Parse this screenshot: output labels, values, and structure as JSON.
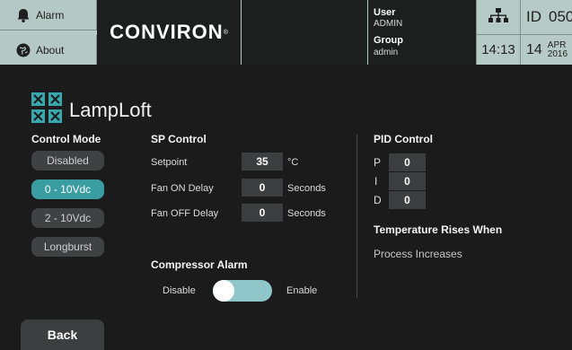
{
  "header": {
    "alarm_label": "Alarm",
    "about_label": "About",
    "brand": "CONVIRON",
    "user_heading": "User",
    "user_value": "ADMIN",
    "group_heading": "Group",
    "group_value": "admin",
    "id_label": "ID",
    "id_value": "050",
    "time": "14:13",
    "day": "14",
    "month": "APR",
    "year": "2016"
  },
  "page": {
    "title": "LampLoft"
  },
  "control_mode": {
    "heading": "Control Mode",
    "options": [
      "Disabled",
      "0 - 10Vdc",
      "2 - 10Vdc",
      "Longburst"
    ],
    "selected": "0 - 10Vdc"
  },
  "sp_control": {
    "heading": "SP Control",
    "setpoint_label": "Setpoint",
    "setpoint_value": "35",
    "setpoint_unit": "°C",
    "fan_on_label": "Fan ON Delay",
    "fan_on_value": "0",
    "fan_on_unit": "Seconds",
    "fan_off_label": "Fan OFF Delay",
    "fan_off_value": "0",
    "fan_off_unit": "Seconds"
  },
  "compressor_alarm": {
    "heading": "Compressor Alarm",
    "disable_label": "Disable",
    "enable_label": "Enable",
    "state": "Disable"
  },
  "pid_control": {
    "heading": "PID Control",
    "p_label": "P",
    "p_value": "0",
    "i_label": "I",
    "i_value": "0",
    "d_label": "D",
    "d_value": "0"
  },
  "temperature_rises": {
    "heading": "Temperature Rises When",
    "value": "Process Increases"
  },
  "footer": {
    "back_label": "Back"
  },
  "colors": {
    "accent": "#3a9da2",
    "header_bg": "#b6cbc7",
    "toggle_track": "#8ec6c9"
  }
}
